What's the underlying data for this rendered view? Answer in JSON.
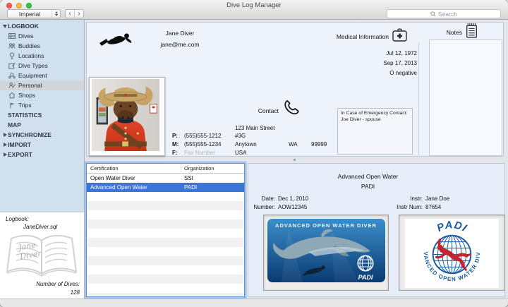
{
  "window": {
    "title": "Dive Log Manager"
  },
  "toolbar": {
    "units": {
      "value": "Imperial"
    },
    "nav": {
      "back": "‹",
      "forward": "›"
    },
    "search": {
      "placeholder": "Search"
    }
  },
  "sidebar": {
    "items": [
      {
        "label": "LOGBOOK"
      },
      {
        "label": "Dives"
      },
      {
        "label": "Buddies"
      },
      {
        "label": "Locations"
      },
      {
        "label": "Dive Types"
      },
      {
        "label": "Equipment"
      },
      {
        "label": "Personal"
      },
      {
        "label": "Shops"
      },
      {
        "label": "Trips"
      },
      {
        "label": "STATISTICS"
      },
      {
        "label": "MAP"
      },
      {
        "label": "SYNCHRONIZE"
      },
      {
        "label": "IMPORT"
      },
      {
        "label": "EXPORT"
      }
    ]
  },
  "logbook_info": {
    "label": "Logbook:",
    "filename": "JaneDiver.sql",
    "watermark": "Jane Diver",
    "dives_label": "Number of Dives:",
    "dives_count": "128"
  },
  "personal": {
    "name": "Jane Diver",
    "email": "jane@me.com",
    "medical": {
      "label": "Medical Information",
      "birthdate": "Jul 12, 1972",
      "date2": "Sep 17, 2013",
      "blood_type": "O negative"
    },
    "contact": {
      "label": "Contact",
      "street": "123 Main Street",
      "unit": "#3G",
      "city": "Anytown",
      "state": "WA",
      "zip": "99999",
      "country": "USA",
      "phone_label": "P:",
      "phone": "(555)555-1212",
      "mobile_label": "M:",
      "mobile": "(555)555-1234",
      "fax_label": "F:",
      "fax_placeholder": "Fax Number"
    },
    "emergency": {
      "title": "In Case of Emergency Contact:",
      "contact": "Joe Diver - spouse"
    },
    "notes_label": "Notes"
  },
  "certifications": {
    "columns": {
      "certification": "Certification",
      "organization": "Organization"
    },
    "rows": [
      {
        "certification": "Open Water Diver",
        "organization": "SSI"
      },
      {
        "certification": "Advanced Open Water",
        "organization": "PADI"
      }
    ]
  },
  "cert_detail": {
    "title": "Advanced Open Water",
    "organization": "PADI",
    "date_label": "Date:",
    "date": "Dec 1, 2010",
    "number_label": "Number:",
    "number": "AOW12345",
    "instructor_label": "Instr:",
    "instructor": "Jane Doe",
    "instructor_num_label": "Instr Num:",
    "instructor_num": "87654",
    "card": {
      "title": "ADVANCED OPEN WATER DIVER",
      "brand": "PADI"
    },
    "logo": {
      "top": "PADI",
      "arc": "ADVANCED OPEN WATER DIVER"
    }
  },
  "colors": {
    "selection_blue": "#3a76d8",
    "sidebar_bg": "#d1e0ef",
    "panel_bg": "#eef2fb",
    "detail_bg": "#e6edf9",
    "card_blue_top": "#3b8ec9",
    "card_blue_bottom": "#0a3a72",
    "padi_blue": "#1a5ca3",
    "padi_red": "#c42432"
  }
}
